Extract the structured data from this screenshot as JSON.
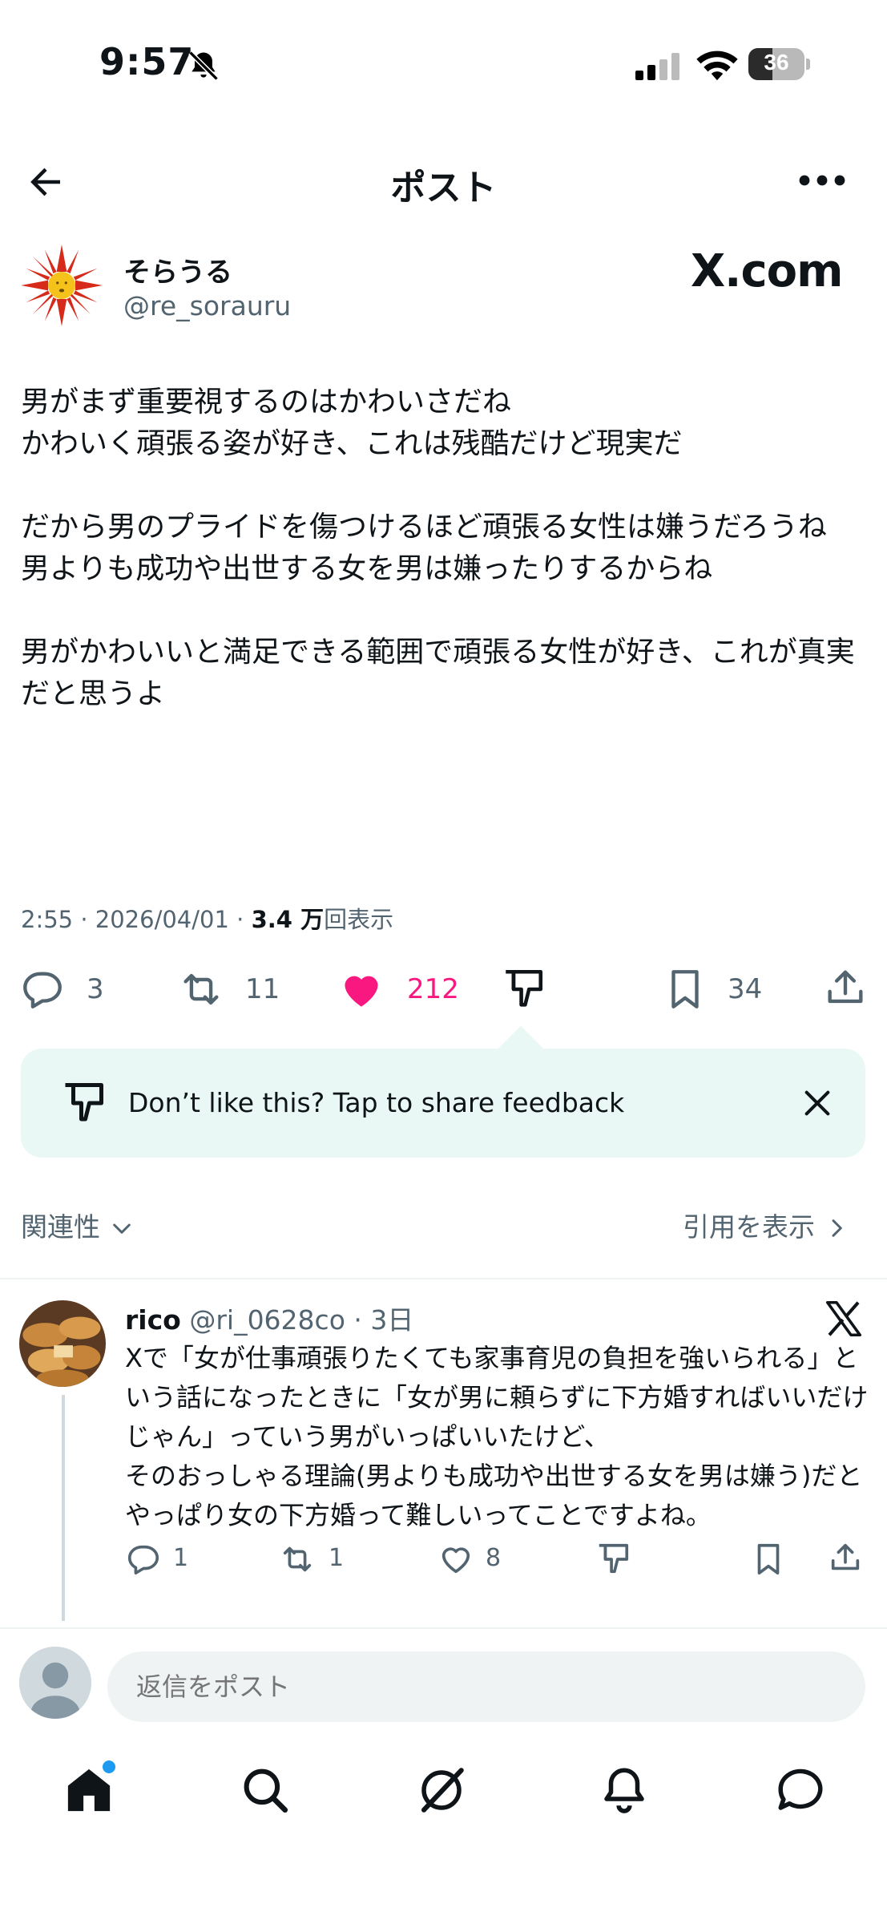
{
  "status_bar": {
    "time": "9:57",
    "battery": "36"
  },
  "header": {
    "title": "ポスト"
  },
  "post": {
    "author_name": "そらうる",
    "author_handle": "@re_sorauru",
    "watermark": "X.com",
    "body": "男がまず重要視するのはかわいさだね\nかわいく頑張る姿が好き、これは残酷だけど現実だ\n\nだから男のプライドを傷つけるほど頑張る女性は嫌うだろうね\n男よりも成功や出世する女を男は嫌ったりするからね\n\n男がかわいいと満足できる範囲で頑張る女性が好き、これが真実だと思うよ",
    "timestamp": "2:55 · 2026/04/01 · ",
    "views_number": "3.4 万",
    "views_label": "回表示",
    "replies": "3",
    "reposts": "11",
    "likes": "212",
    "bookmarks": "34",
    "liked": true
  },
  "feedback": {
    "text": "Don’t like this? Tap to share feedback"
  },
  "sort": {
    "left_label": "関連性",
    "right_label": "引用を表示"
  },
  "reply": {
    "name": "rico",
    "handle_time": "@ri_0628co · 3日",
    "body": "Xで「女が仕事頑張りたくても家事育児の負担を強いられる」という話になったときに「女が男に頼らずに下方婚すればいいだけじゃん」っていう男がいっぱいいたけど、\nそのおっしゃる理論(男よりも成功や出世する女を男は嫌う)だとやっぱり女の下方婚って難しいってことですよね。",
    "replies": "1",
    "reposts": "1",
    "likes": "8"
  },
  "compose": {
    "placeholder": "返信をポスト"
  },
  "colors": {
    "like": "#f91880",
    "feedback_bg": "#e9f8f4",
    "accent": "#1d9bf0",
    "secondary_text": "#536471"
  }
}
